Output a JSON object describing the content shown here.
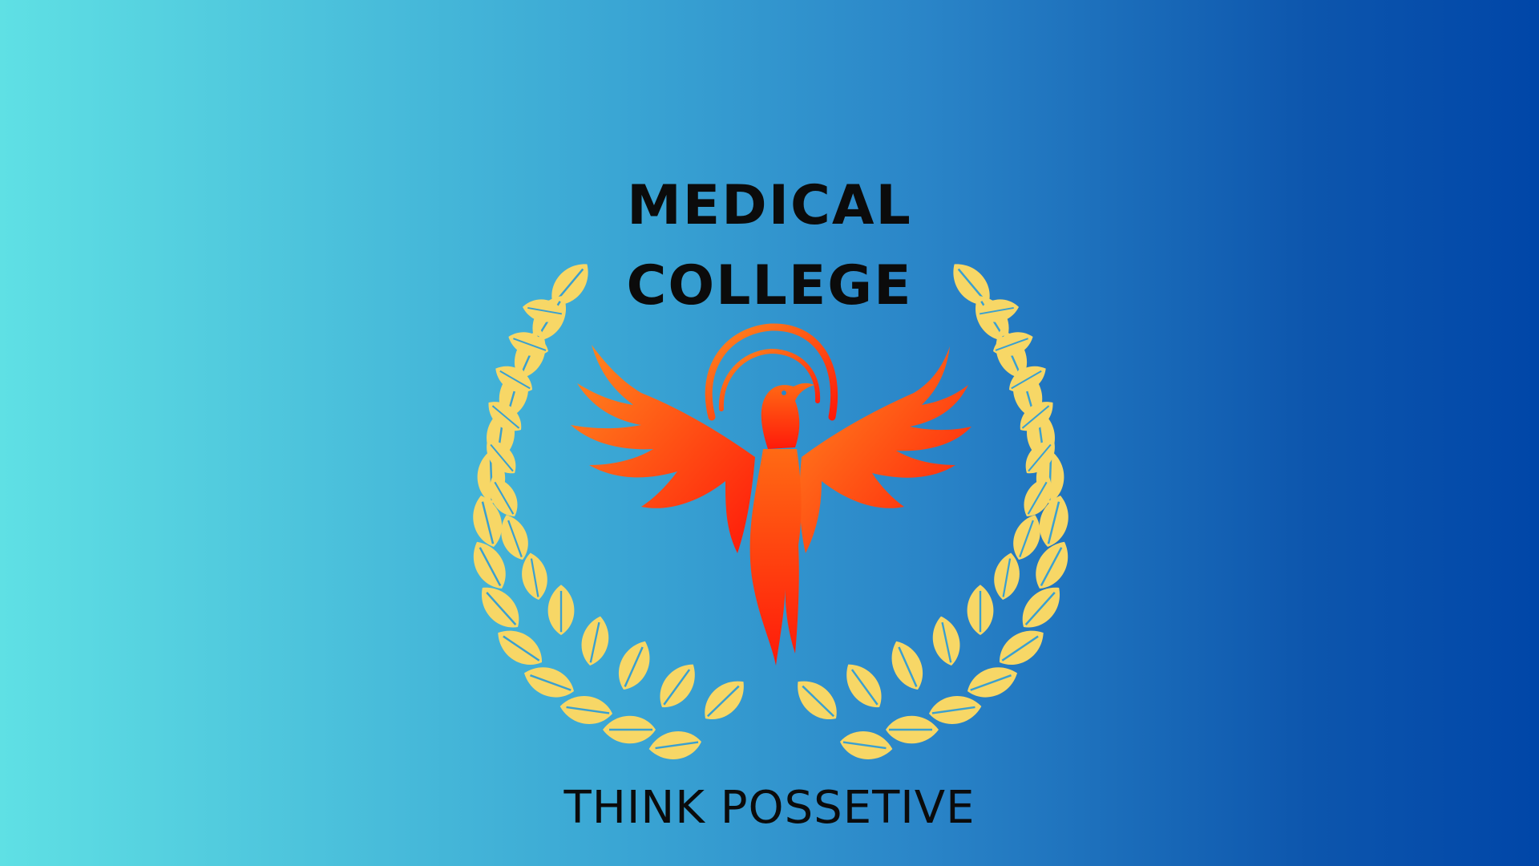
{
  "logo": {
    "title_line_1": "MEDICAL",
    "title_line_2": "COLLEGE",
    "tagline": "THINK POSSETIVE"
  },
  "colors": {
    "background_left": "#5fe0e4",
    "background_right": "#0046a8",
    "text": "#0b0b0b",
    "laurel": "#f7d766",
    "phoenix_top": "#ff8a1f",
    "phoenix_bottom": "#ff1a0a"
  },
  "icons": {
    "emblem": "phoenix-icon",
    "wreath": "laurel-wreath-icon"
  }
}
